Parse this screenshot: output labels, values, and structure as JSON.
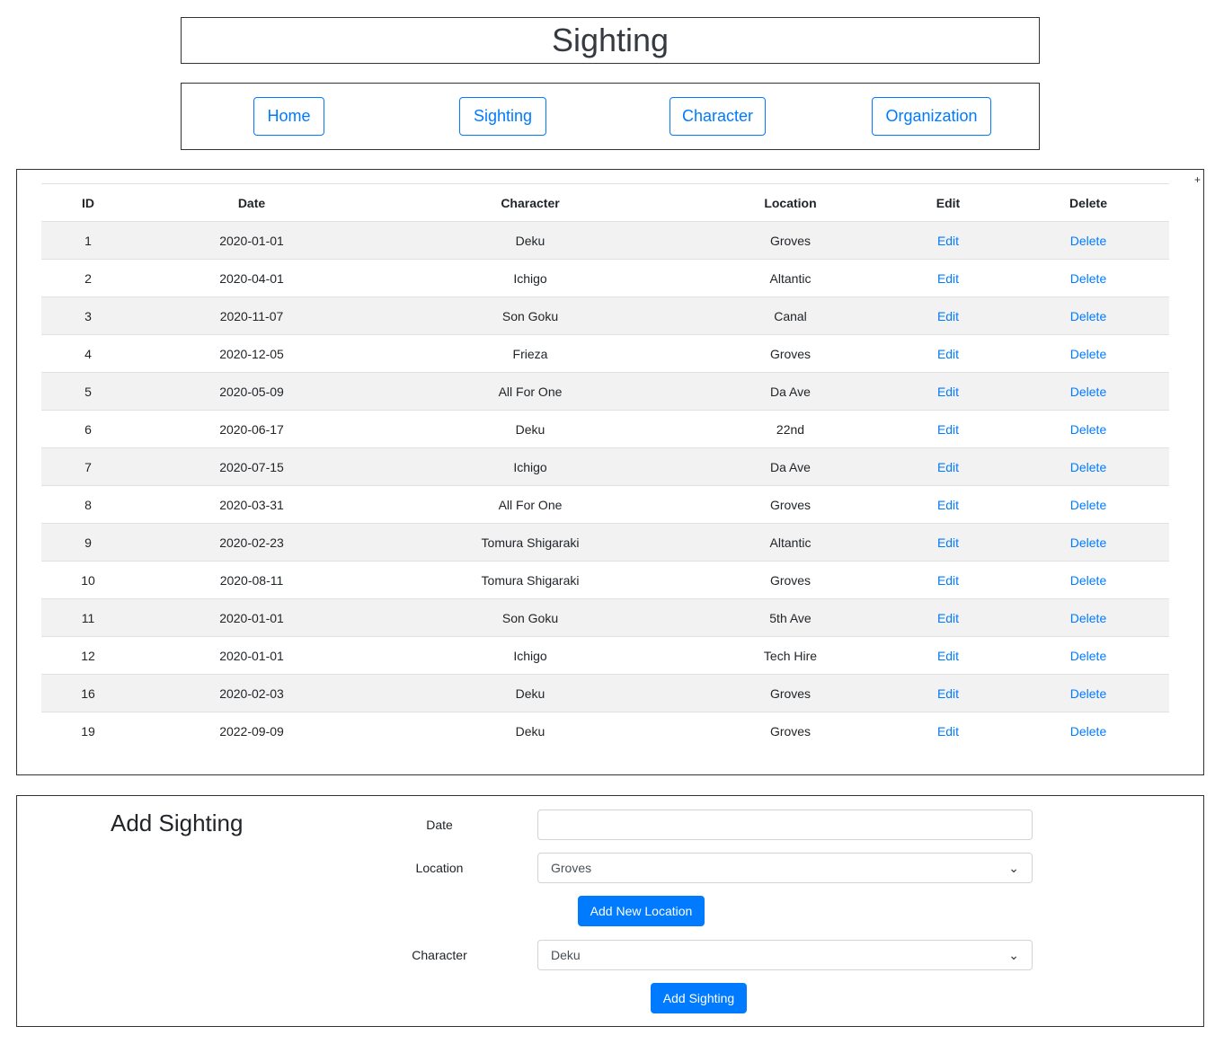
{
  "header": {
    "title": "Sighting"
  },
  "nav": {
    "home": "Home",
    "sighting": "Sighting",
    "character": "Character",
    "organization": "Organization"
  },
  "table": {
    "corner_mark": "+",
    "columns": [
      "ID",
      "Date",
      "Character",
      "Location",
      "Edit",
      "Delete"
    ],
    "rows": [
      {
        "id": "1",
        "date": "2020-01-01",
        "character": "Deku",
        "location": "Groves",
        "edit": "Edit",
        "delete": "Delete"
      },
      {
        "id": "2",
        "date": "2020-04-01",
        "character": "Ichigo",
        "location": "Altantic",
        "edit": "Edit",
        "delete": "Delete"
      },
      {
        "id": "3",
        "date": "2020-11-07",
        "character": "Son Goku",
        "location": "Canal",
        "edit": "Edit",
        "delete": "Delete"
      },
      {
        "id": "4",
        "date": "2020-12-05",
        "character": "Frieza",
        "location": "Groves",
        "edit": "Edit",
        "delete": "Delete"
      },
      {
        "id": "5",
        "date": "2020-05-09",
        "character": "All For One",
        "location": "Da Ave",
        "edit": "Edit",
        "delete": "Delete"
      },
      {
        "id": "6",
        "date": "2020-06-17",
        "character": "Deku",
        "location": "22nd",
        "edit": "Edit",
        "delete": "Delete"
      },
      {
        "id": "7",
        "date": "2020-07-15",
        "character": "Ichigo",
        "location": "Da Ave",
        "edit": "Edit",
        "delete": "Delete"
      },
      {
        "id": "8",
        "date": "2020-03-31",
        "character": "All For One",
        "location": "Groves",
        "edit": "Edit",
        "delete": "Delete"
      },
      {
        "id": "9",
        "date": "2020-02-23",
        "character": "Tomura Shigaraki",
        "location": "Altantic",
        "edit": "Edit",
        "delete": "Delete"
      },
      {
        "id": "10",
        "date": "2020-08-11",
        "character": "Tomura Shigaraki",
        "location": "Groves",
        "edit": "Edit",
        "delete": "Delete"
      },
      {
        "id": "11",
        "date": "2020-01-01",
        "character": "Son Goku",
        "location": "5th Ave",
        "edit": "Edit",
        "delete": "Delete"
      },
      {
        "id": "12",
        "date": "2020-01-01",
        "character": "Ichigo",
        "location": "Tech Hire",
        "edit": "Edit",
        "delete": "Delete"
      },
      {
        "id": "16",
        "date": "2020-02-03",
        "character": "Deku",
        "location": "Groves",
        "edit": "Edit",
        "delete": "Delete"
      },
      {
        "id": "19",
        "date": "2022-09-09",
        "character": "Deku",
        "location": "Groves",
        "edit": "Edit",
        "delete": "Delete"
      }
    ]
  },
  "form": {
    "title": "Add Sighting",
    "date_label": "Date",
    "date_value": "",
    "location_label": "Location",
    "location_selected": "Groves",
    "add_location_button": "Add New Location",
    "character_label": "Character",
    "character_selected": "Deku",
    "submit_button": "Add Sighting"
  },
  "colors": {
    "primary": "#007bff",
    "stripe": "#f2f2f2",
    "border": "#333333"
  }
}
